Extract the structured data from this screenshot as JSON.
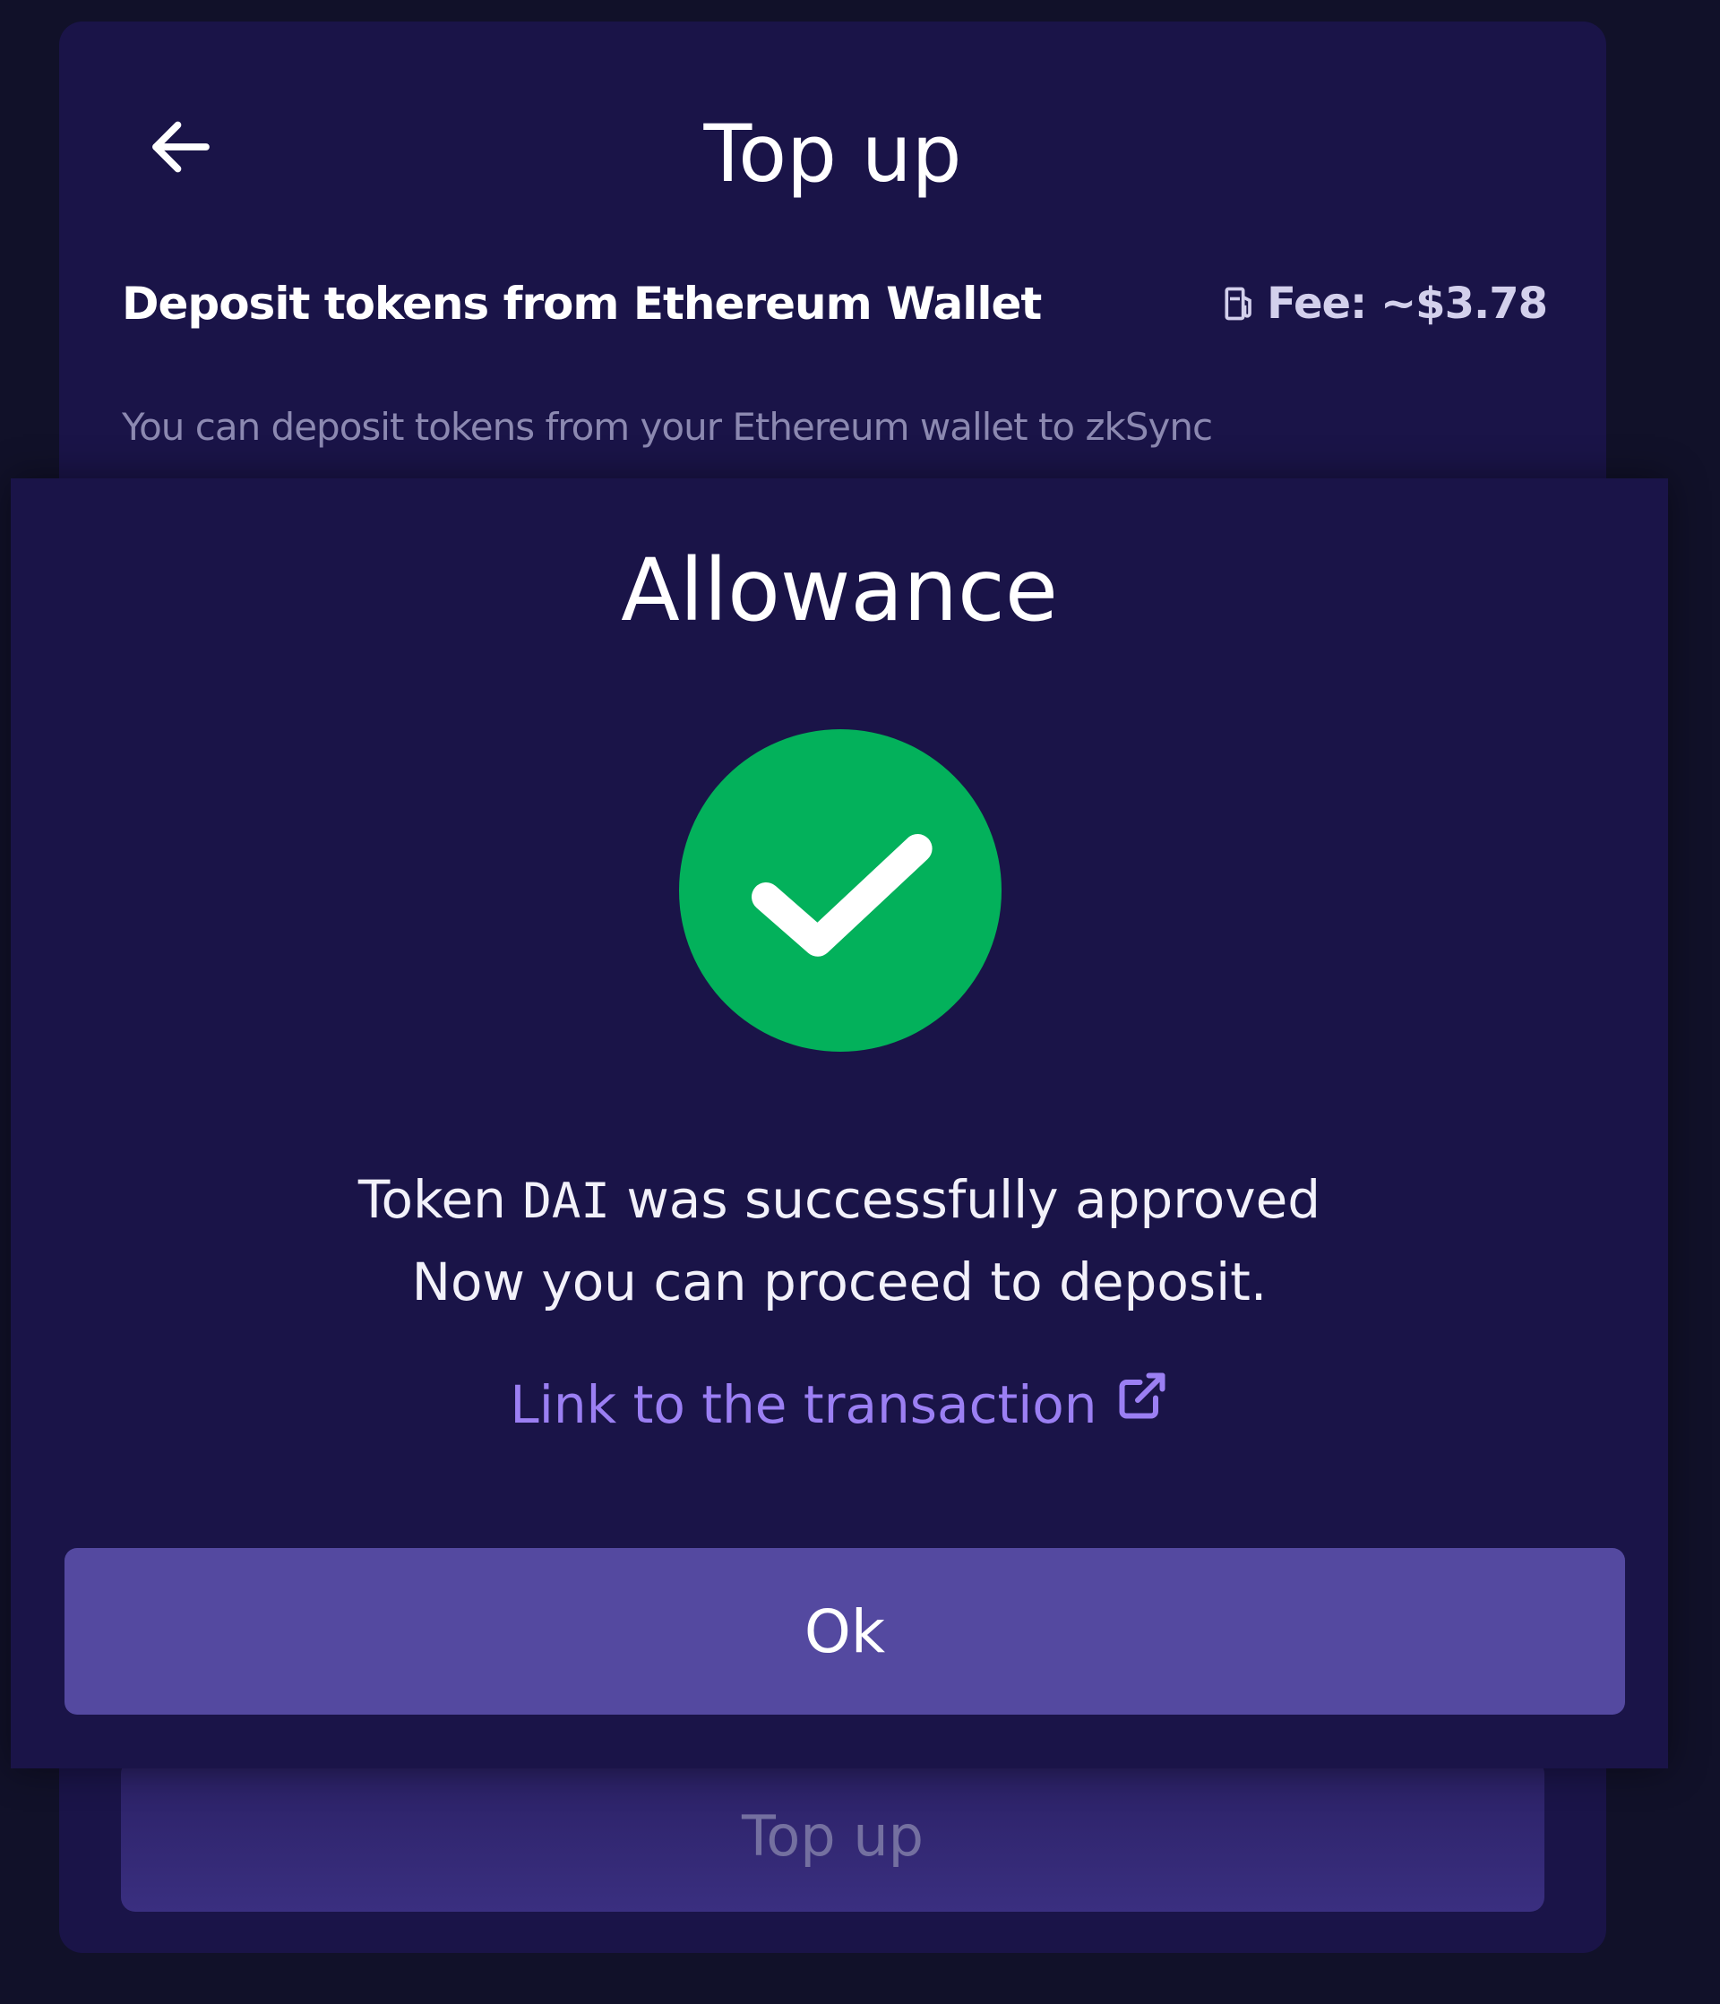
{
  "background_card": {
    "title": "Top up",
    "deposit_label": "Deposit tokens from Ethereum Wallet",
    "fee_text": "Fee: ~$3.78",
    "description": "You can deposit tokens from your Ethereum wallet to zkSync",
    "topup_button_label": "Top up"
  },
  "modal": {
    "title": "Allowance",
    "message_prefix": "Token",
    "token": "DAI",
    "message_suffix": "was successfully approved",
    "message_line2": "Now you can proceed to deposit.",
    "link_text": "Link to the transaction",
    "ok_label": "Ok"
  },
  "colors": {
    "page_background": "#111129",
    "card_background": "#1a1448",
    "success_green": "#03b15b",
    "link_purple": "#9b7ff3",
    "button_purple": "#5449a0"
  },
  "icons": {
    "back": "arrow-left-icon",
    "fee": "gas-pump-icon",
    "success": "check-circle-icon",
    "external": "external-link-icon"
  }
}
